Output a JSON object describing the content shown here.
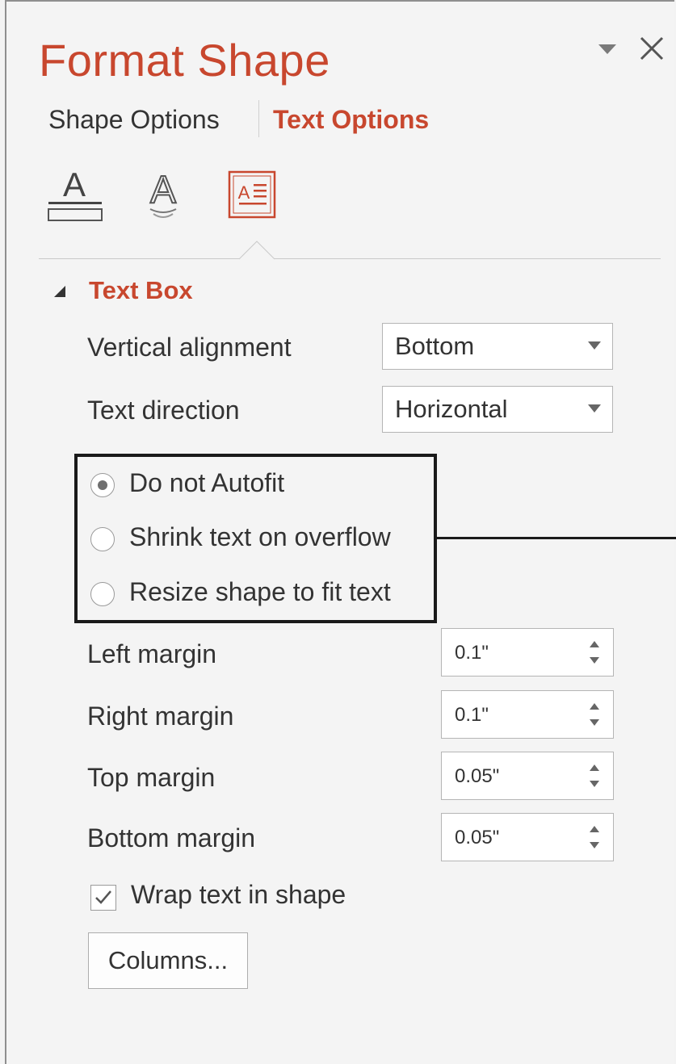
{
  "pane": {
    "title": "Format Shape",
    "menu_icon": "chevron-down-icon",
    "close_icon": "close-icon"
  },
  "tabs": [
    {
      "label": "Shape Options",
      "selected": false
    },
    {
      "label": "Text Options",
      "selected": true
    }
  ],
  "category_icons": [
    {
      "name": "text-fill-outline-icon",
      "selected": false
    },
    {
      "name": "text-effects-icon",
      "selected": false
    },
    {
      "name": "textbox-icon",
      "selected": true
    }
  ],
  "section": {
    "title": "Text Box",
    "expanded": true
  },
  "vertical_alignment": {
    "label": "Vertical alignment",
    "value": "Bottom"
  },
  "text_direction": {
    "label": "Text direction",
    "value": "Horizontal"
  },
  "autofit": {
    "options": [
      {
        "label": "Do not Autofit",
        "selected": true
      },
      {
        "label": "Shrink text on overflow",
        "selected": false
      },
      {
        "label": "Resize shape to fit text",
        "selected": false
      }
    ]
  },
  "margins": [
    {
      "label": "Left margin",
      "value": "0.1\""
    },
    {
      "label": "Right margin",
      "value": "0.1\""
    },
    {
      "label": "Top margin",
      "value": "0.05\""
    },
    {
      "label": "Bottom margin",
      "value": "0.05\""
    }
  ],
  "wrap_text": {
    "label": "Wrap text in shape",
    "checked": true
  },
  "columns_button": {
    "label": "Columns..."
  },
  "colors": {
    "accent": "#c8472e",
    "text": "#333333",
    "background": "#f4f4f4"
  }
}
